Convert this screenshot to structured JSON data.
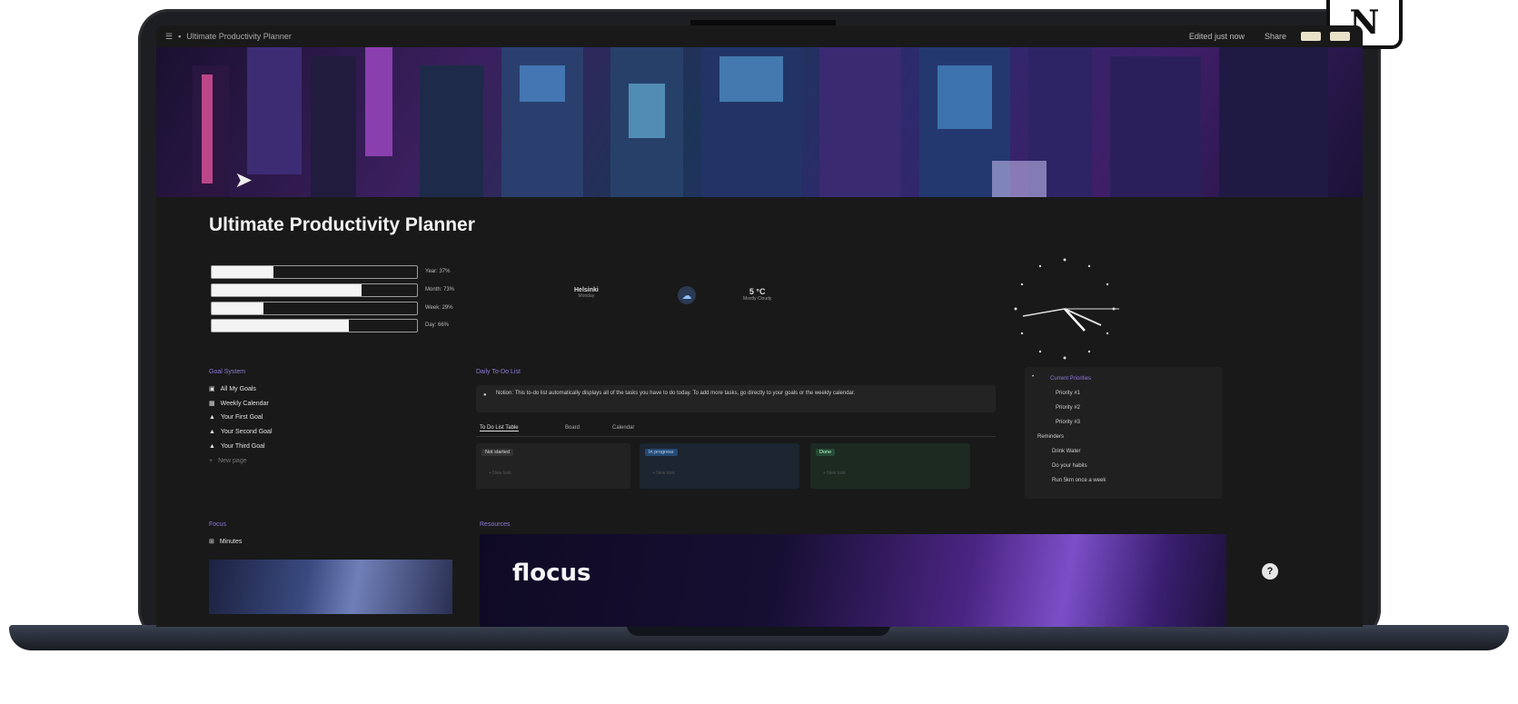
{
  "branding": {
    "notion_badge": "N"
  },
  "topbar": {
    "breadcrumb": "Ultimate Productivity Planner",
    "share_label": "Share",
    "edited_label": "Edited just now"
  },
  "page": {
    "title": "Ultimate Productivity Planner"
  },
  "progress": [
    {
      "label": "Year: 37%",
      "value": 0.3
    },
    {
      "label": "Month: 73%",
      "value": 0.73
    },
    {
      "label": "Week: 29%",
      "value": 0.25
    },
    {
      "label": "Day: 66%",
      "value": 0.67
    }
  ],
  "weather": {
    "city": "Helsinki",
    "city_sub": "Monday",
    "temp": "5 °C",
    "condition": "Mostly Cloudy"
  },
  "goal_system": {
    "title": "Goal System",
    "items": [
      "All My Goals",
      "Weekly Calendar",
      "Your First Goal",
      "Your Second Goal",
      "Your Third Goal",
      "New page"
    ]
  },
  "daily": {
    "title": "Daily To-Do List",
    "callout": "Notion: This to-do list automatically displays all of the tasks you have to do today. To add more tasks, go directly to your goals or the weekly calendar.",
    "tabs": [
      "To Do List Table",
      "Board",
      "Calendar"
    ],
    "columns": [
      {
        "label": "Not started",
        "sub": "+ New task"
      },
      {
        "label": "In progress",
        "sub": "+ New task"
      },
      {
        "label": "Done",
        "sub": "+ New task"
      }
    ]
  },
  "sidebar_panel": {
    "heading": "Current Priorities",
    "items": [
      "Priority #1",
      "Priority #2",
      "Priority #3"
    ],
    "sub_heading": "Reminders",
    "reminders": [
      "Drink Water",
      "Do your habits",
      "Run 5km once a week"
    ]
  },
  "focus": {
    "title": "Focus",
    "item": "Minutes"
  },
  "resources": {
    "title": "Resources",
    "brand": "flocus"
  },
  "help": {
    "label": "?"
  },
  "colors": {
    "accent": "#8e7ad8",
    "background": "#191919"
  }
}
